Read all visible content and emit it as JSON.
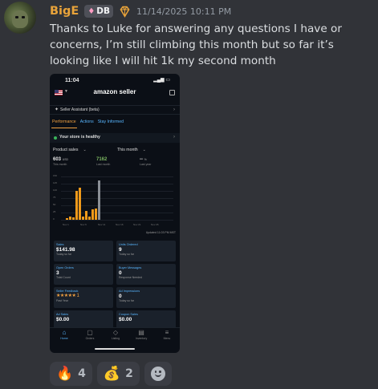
{
  "message": {
    "username": "BigE",
    "user_color": "#e8a33a",
    "tag": "DB",
    "timestamp": "11/14/2025 10:11 PM",
    "text": "Thanks to Luke for answering any questions I have or concerns, I’m still climbing this month but so far it’s looking like I will hit 1k my second month"
  },
  "screenshot": {
    "status_time": "11:04",
    "brand": "amazon seller",
    "assistant_label": "Seller Assistant (beta)",
    "tabs": [
      "Performance",
      "Actions",
      "Stay Informed"
    ],
    "active_tab": "Performance",
    "healthy": "Your store is healthy",
    "metric_selector": "Product sales",
    "period_selector": "This month",
    "metrics": [
      {
        "value": "603",
        "unit": "USD",
        "caption": "This month"
      },
      {
        "value": "7162",
        "unit": "",
        "caption": "Last month"
      },
      {
        "value": "--",
        "unit": "%",
        "caption": "Last year"
      }
    ],
    "updated": "Updated 11:03 PM MST",
    "cards": [
      {
        "title": "Sales",
        "value": "$141.98",
        "sub": "Today so far"
      },
      {
        "title": "Units Ordered",
        "value": "9",
        "sub": "Today so far"
      },
      {
        "title": "Open Orders",
        "value": "3",
        "sub": "Total Count"
      },
      {
        "title": "Buyer Messages",
        "value": "0",
        "sub": "Response Needed"
      },
      {
        "title": "Seller Feedback",
        "value": "★★★★★ 1",
        "sub": "Past Year"
      },
      {
        "title": "Ad Impressions",
        "value": "0",
        "sub": "Today so far"
      },
      {
        "title": "Ad Sales",
        "value": "$0.00",
        "sub": ""
      },
      {
        "title": "Coupon Sales",
        "value": "$0.00",
        "sub": ""
      }
    ],
    "tabbar": [
      {
        "label": "Home",
        "icon": "home-icon"
      },
      {
        "label": "Orders",
        "icon": "orders-icon"
      },
      {
        "label": "Listing",
        "icon": "tag-icon"
      },
      {
        "label": "Inventory",
        "icon": "inventory-icon"
      },
      {
        "label": "Menu",
        "icon": "menu-icon"
      }
    ]
  },
  "chart_data": {
    "type": "bar",
    "ylim": [
      0,
      150
    ],
    "yticks": [
      "150",
      "125",
      "100",
      "75",
      "50",
      "25",
      "0"
    ],
    "x_labels": [
      "Nov 1",
      "Nov 6",
      "Nov 11",
      "Nov 16",
      "Nov 21",
      "Nov 26"
    ],
    "values": [
      5,
      12,
      8,
      100,
      112,
      12,
      30,
      12,
      35,
      40,
      137
    ],
    "colors": [
      "orange",
      "orange",
      "orange",
      "orange",
      "orange",
      "orange",
      "orange",
      "orange",
      "orange",
      "orange",
      "gray"
    ]
  },
  "reactions": [
    {
      "emoji": "🔥",
      "count": "4"
    },
    {
      "emoji": "💰",
      "count": "2"
    }
  ]
}
